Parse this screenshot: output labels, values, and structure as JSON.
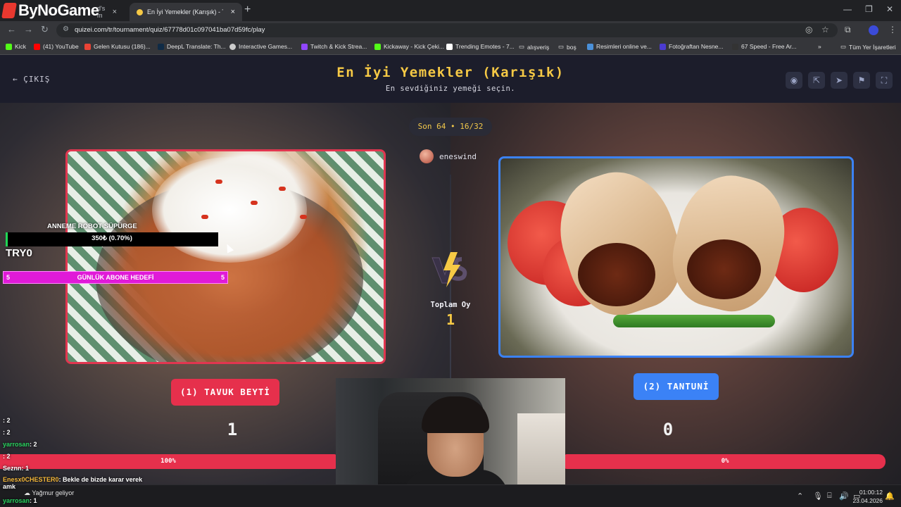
{
  "browser": {
    "tabs": [
      {
        "label": "d's m"
      },
      {
        "label": "En İyi Yemekler (Karışık) - Tier L"
      }
    ],
    "url": "quizei.com/tr/tournament/quiz/67778d01c097041ba07d59fc/play",
    "bookmarks": [
      {
        "label": "Kick",
        "color": "#53fc18"
      },
      {
        "label": "(41) YouTube",
        "color": "#ff0000"
      },
      {
        "label": "Gelen Kutusu (186)...",
        "color": "#ea4335"
      },
      {
        "label": "DeepL Translate: Th...",
        "color": "#0f2b46"
      },
      {
        "label": "Interactive Games...",
        "color": "#cccccc"
      },
      {
        "label": "Twitch & Kick Strea...",
        "color": "#9146ff"
      },
      {
        "label": "Kickaway - Kick Çeki...",
        "color": "#53fc18"
      },
      {
        "label": "Trending Emotes - 7...",
        "color": "#ffffff"
      },
      {
        "label": "alışveriş",
        "color": "#9aa0a6"
      },
      {
        "label": "boş",
        "color": "#9aa0a6"
      },
      {
        "label": "Resimleri online ve...",
        "color": "#4a90d9"
      },
      {
        "label": "Fotoğraftan Nesne...",
        "color": "#4b3bd1"
      },
      {
        "label": "67 Speed - Free Ar...",
        "color": "#333333"
      }
    ],
    "all_bookmarks": "Tüm Yer İşaretleri"
  },
  "stream": {
    "logo": "ByNoGame",
    "goal_label": "ANNEME ROBOT SÜPÜRGE",
    "goal_value": "350₺ (0.70%)",
    "try_label": "TRY0",
    "sub_goal": {
      "left": "5",
      "label": "GÜNLÜK ABONE HEDEFİ",
      "right": "5"
    },
    "chat": [
      {
        "user": "",
        "text": ": 2",
        "color": "#c83e3e"
      },
      {
        "user": "",
        "text": ": 2",
        "color": "#e1462d"
      },
      {
        "user": "yarrosan",
        "text": ": 2",
        "color": "#29d35f"
      },
      {
        "user": "",
        "text": ": 2",
        "color": "#3d7bd8"
      },
      {
        "user": "Seznn",
        "text": ": 1",
        "color": "#ffffff"
      },
      {
        "user": "Enesx0CHESTER0",
        "text": ": Bekle de bizde karar verek",
        "color": "#f5b83a"
      },
      {
        "user": "amk",
        "text": "",
        "color": "#ffffff"
      },
      {
        "user": "yarrosan",
        "text": ": 1",
        "color": "#29d35f"
      }
    ]
  },
  "page": {
    "exit_label": "ÇIKIŞ",
    "title": "En İyi Yemekler (Karışık)",
    "subtitle": "En sevdiğiniz yemeği seçin.",
    "round": "Son 64 • 16/32",
    "username": "eneswind",
    "total_label": "Toplam Oy",
    "total_votes": "1",
    "left": {
      "button": "(1) TAVUK BEYTİ",
      "votes": "1",
      "percent_label": "100%",
      "percent": 100
    },
    "right": {
      "button": "(2) TANTUNİ",
      "votes": "0",
      "percent_label": "0%",
      "percent": 0
    },
    "accent_left": "#e6304c",
    "accent_right": "#3b82f6",
    "title_color": "#f6c945"
  },
  "taskbar": {
    "weather": "Yağmur geliyor",
    "time": "01:00:12",
    "date": "23.04.2026"
  }
}
